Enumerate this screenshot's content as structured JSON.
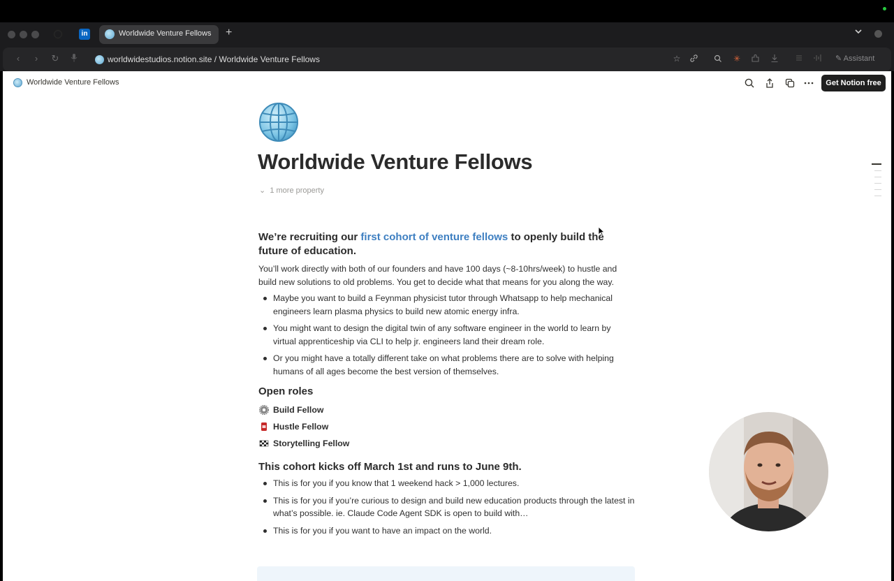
{
  "browser": {
    "active_tab_title": "Worldwide Venture Fellows",
    "linkedin_label": "in",
    "new_tab_symbol": "+",
    "url_domain": "worldwidestudios.notion.site",
    "url_separator": "/",
    "url_page": "Worldwide Venture Fellows",
    "assistant_label": "Assistant"
  },
  "notion_header": {
    "page_breadcrumb": "Worldwide Venture Fellows",
    "cta_label": "Get Notion free"
  },
  "page": {
    "title": "Worldwide Venture Fellows",
    "more_property": "1 more property",
    "intro_heading_pre": "We’re recruiting our ",
    "intro_heading_link": "first cohort of venture fellows",
    "intro_heading_post": " to openly build the future of education.",
    "intro_paragraph": "You’ll work directly with both of our founders and have 100 days (~8-10hrs/week) to hustle and build new solutions to old problems. You get to decide what that means for you along the way.",
    "ideas": [
      "Maybe you want to build a Feynman physicist tutor through Whatsapp to help mechanical engineers learn plasma physics to build new atomic energy infra.",
      "You might want to design the digital twin of any software engineer in the world to learn by virtual apprenticeship via CLI to help jr. engineers land their dream role.",
      "Or you might have a totally different take on what problems there are to solve with helping humans of all ages become the best version of themselves."
    ],
    "roles_heading": "Open roles",
    "roles": [
      {
        "icon": "gear-icon",
        "label": "Build Fellow"
      },
      {
        "icon": "soda-can-icon",
        "label": "Hustle Fellow"
      },
      {
        "icon": "checkered-flag-icon",
        "label": "Storytelling Fellow"
      }
    ],
    "cohort_heading": "This cohort kicks off March 1st and runs to June 9th.",
    "fit": [
      "This is for you if you know that 1 weekend hack > 1,000 lectures.",
      "This is for you if you’re curious to design and build new education products through the latest in what’s possible. ie. Claude Code Agent SDK is open to build with…",
      "This is for you if you want to have an impact on the world."
    ]
  },
  "colors": {
    "link": "#3e7fc1",
    "cta_bg": "#1f1f1f",
    "callout_bg": "#eef5fb"
  }
}
